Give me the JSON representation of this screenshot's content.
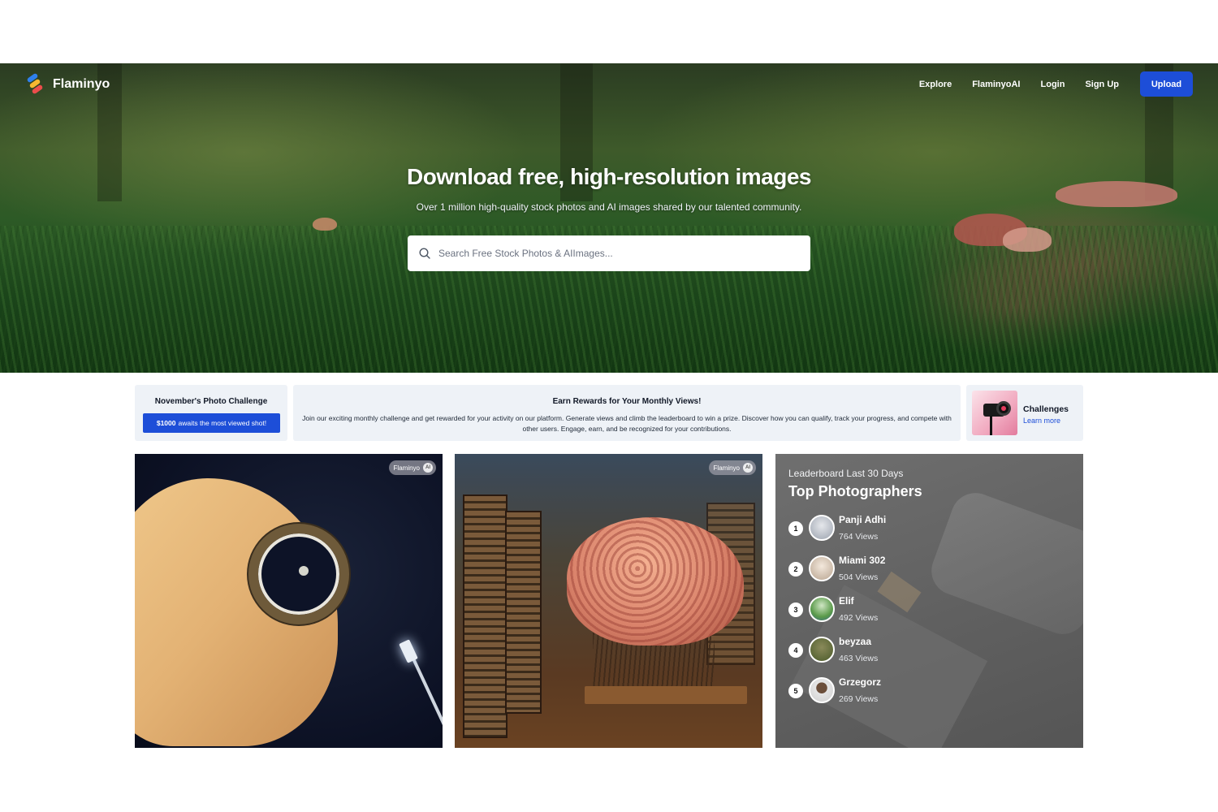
{
  "brand": {
    "name": "Flaminyo",
    "logo_colors": [
      "#2f80ed",
      "#f7b731",
      "#eb4d4b"
    ]
  },
  "nav": {
    "items": [
      {
        "label": "Explore"
      },
      {
        "label": "FlaminyoAI"
      },
      {
        "label": "Login"
      },
      {
        "label": "Sign Up"
      }
    ],
    "upload_label": "Upload"
  },
  "hero": {
    "title": "Download free, high-resolution images",
    "subtitle": "Over 1 million high-quality stock photos and AI images shared by our talented community.",
    "search_placeholder": "Search Free Stock Photos & AIImages..."
  },
  "challenge": {
    "title": "November's Photo Challenge",
    "prize_amount": "$1000",
    "prize_text": "awaits the most viewed shot!"
  },
  "rewards": {
    "title": "Earn Rewards for Your Monthly Views!",
    "text": "Join our exciting monthly challenge and get rewarded for your activity on our platform. Generate views and climb the leaderboard to win a prize. Discover how you can qualify, track your progress, and compete with other users. Engage, earn, and be recognized for your contributions."
  },
  "challenges_card": {
    "title": "Challenges",
    "link": "Learn more"
  },
  "cards": [
    {
      "badge": "Flaminyo",
      "badge_icon": "AI"
    },
    {
      "badge": "Flaminyo",
      "badge_icon": "AI"
    }
  ],
  "leaderboard": {
    "caption": "Leaderboard Last 30 Days",
    "title": "Top Photographers",
    "entries": [
      {
        "rank": "1",
        "name": "Panji Adhi",
        "views": "764 Views"
      },
      {
        "rank": "2",
        "name": "Miami 302",
        "views": "504 Views"
      },
      {
        "rank": "3",
        "name": "Elif",
        "views": "492 Views"
      },
      {
        "rank": "4",
        "name": "beyzaa",
        "views": "463 Views"
      },
      {
        "rank": "5",
        "name": "Grzegorz",
        "views": "269 Views"
      }
    ]
  },
  "colors": {
    "accent": "#1d4ed8",
    "strip_bg": "#eef2f7"
  }
}
